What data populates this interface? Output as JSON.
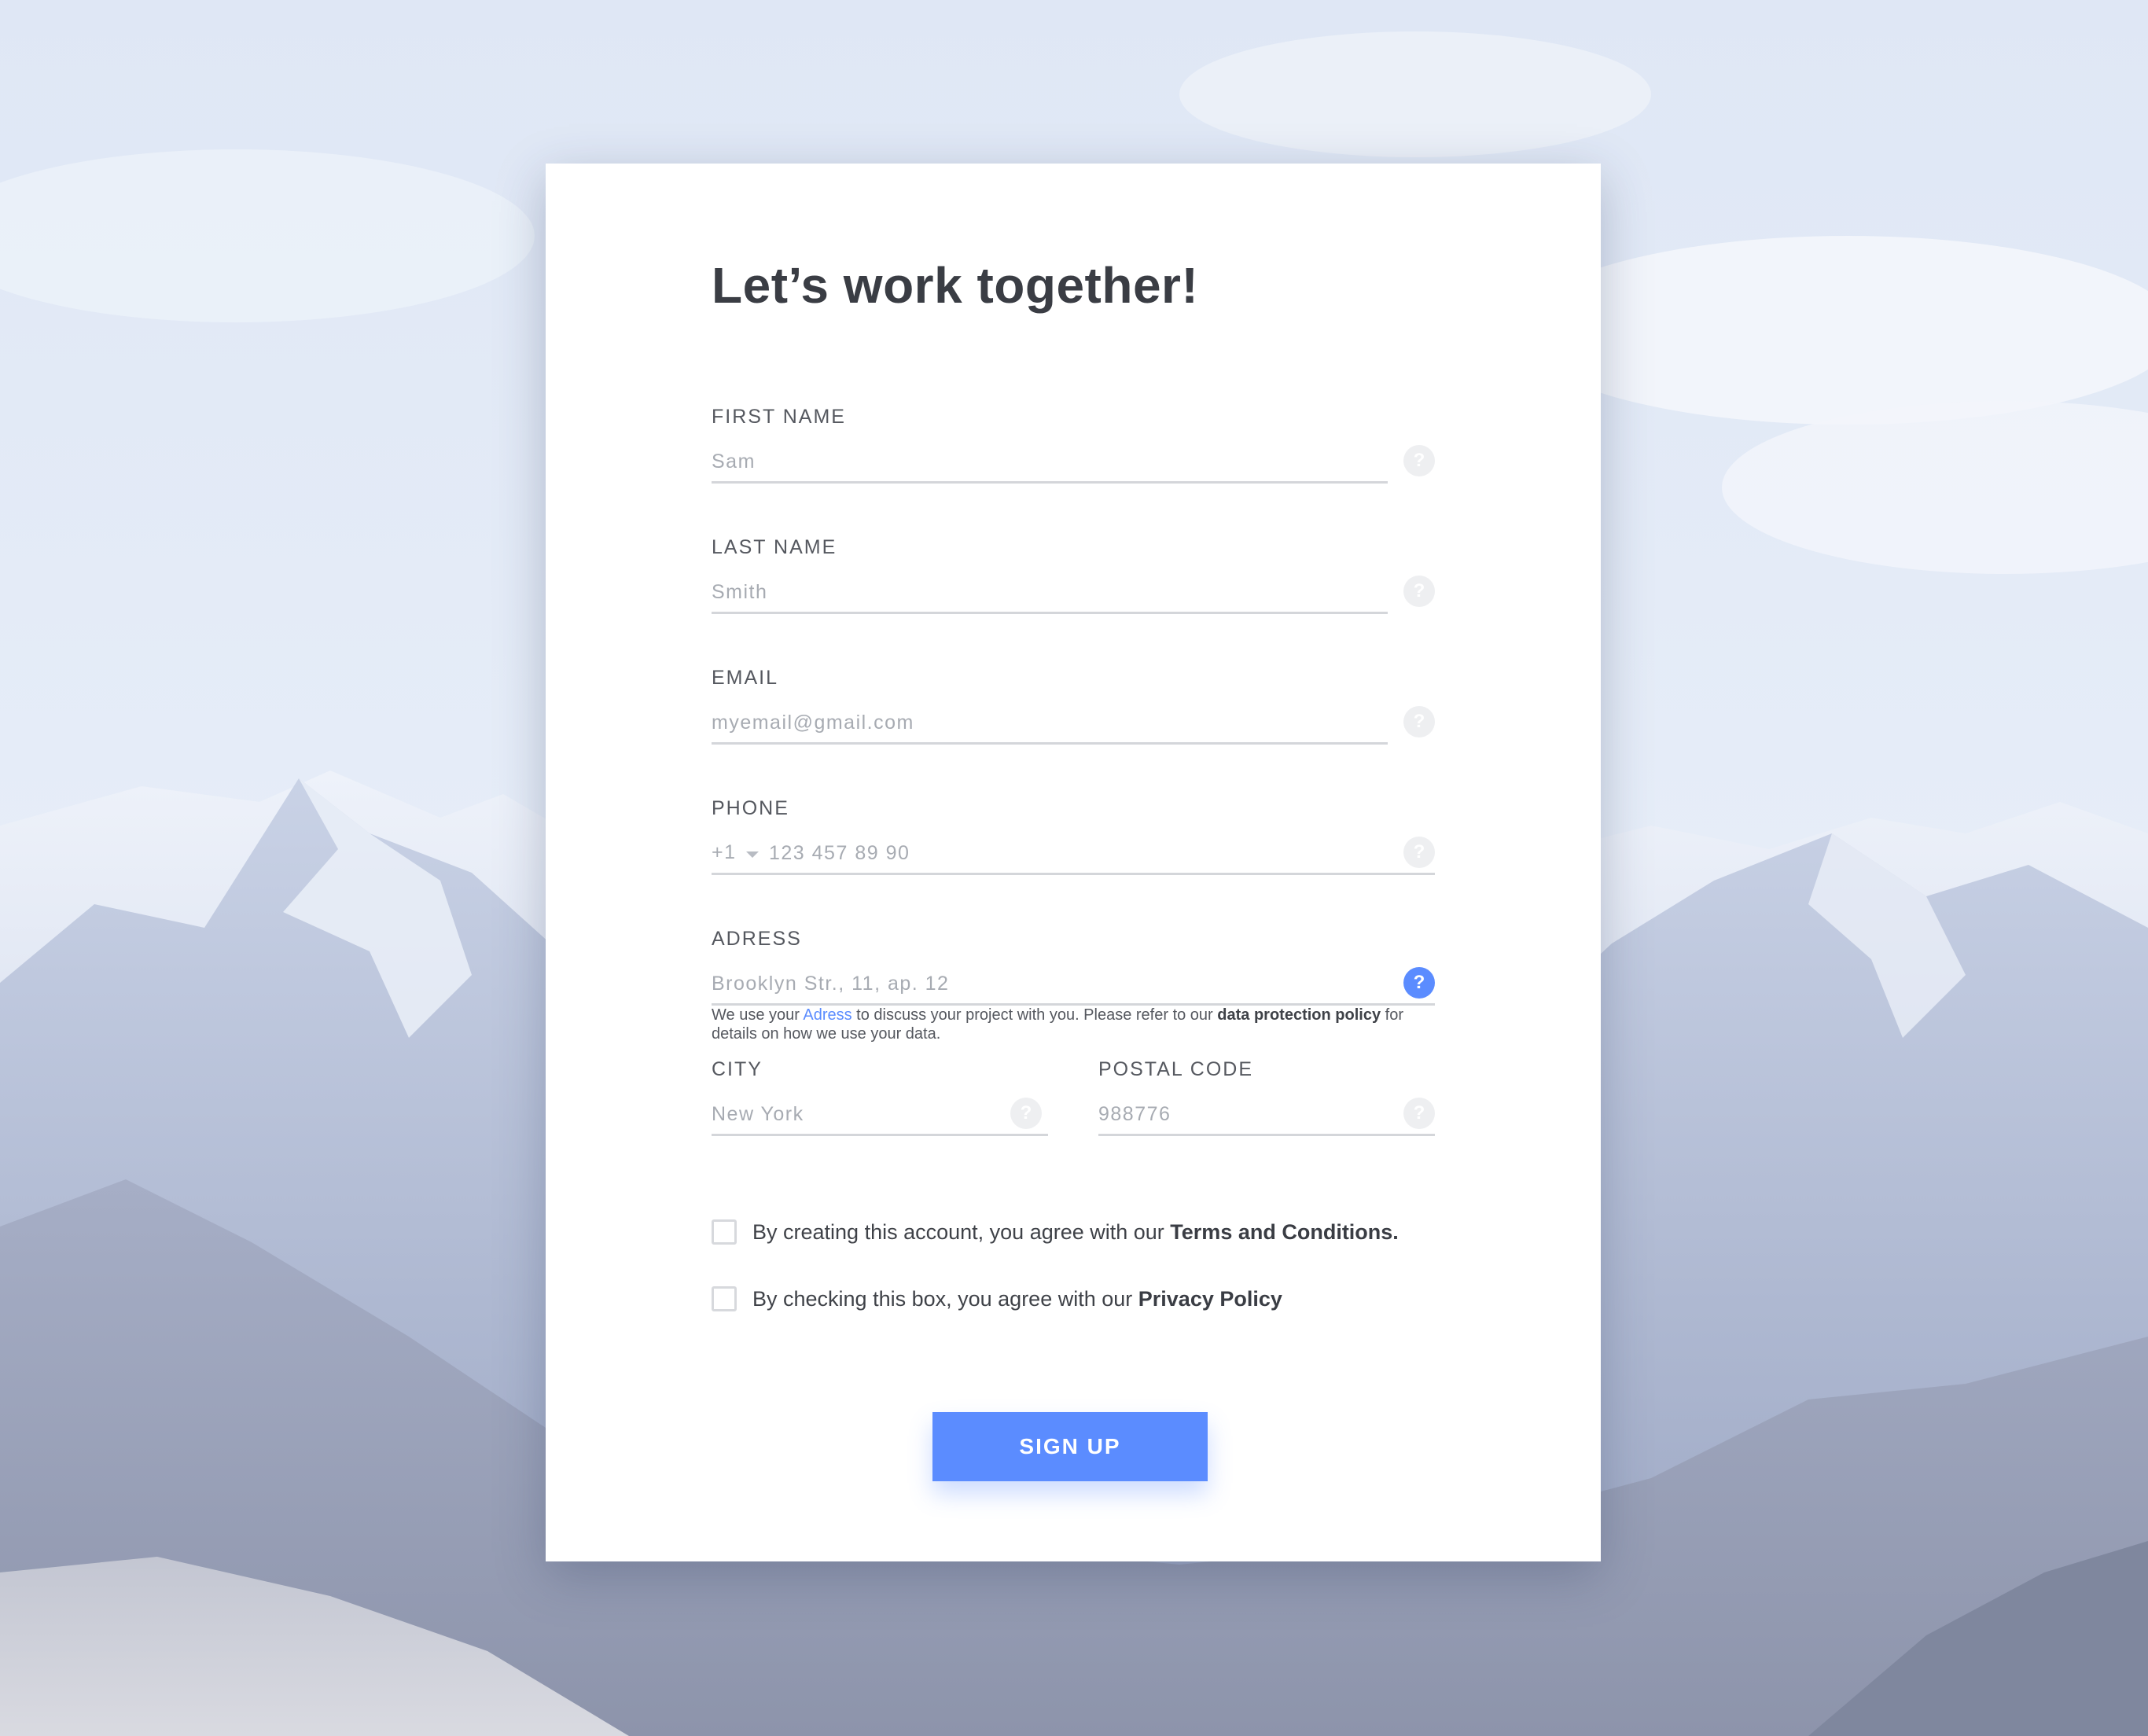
{
  "form": {
    "title": "Let’s work together!",
    "fields": {
      "first_name": {
        "label": "FIRST NAME",
        "placeholder": "Sam",
        "help": "?"
      },
      "last_name": {
        "label": "LAST NAME",
        "placeholder": "Smith",
        "help": "?"
      },
      "email": {
        "label": "EMAIL",
        "placeholder": "myemail@gmail.com",
        "help": "?"
      },
      "phone": {
        "label": "PHONE",
        "country_code": "+1",
        "placeholder": "123 457 89 90",
        "help": "?"
      },
      "address": {
        "label": "ADRESS",
        "placeholder": "Brooklyn Str., 11, ap. 12",
        "help": "?"
      },
      "city": {
        "label": "CITY",
        "placeholder": "New York",
        "help": "?"
      },
      "postal_code": {
        "label": "POSTAL CODE",
        "placeholder": "988776",
        "help": "?"
      }
    },
    "address_hint": {
      "part1": "We use your ",
      "link": "Adress",
      "part2": " to discuss your project with you. Please refer to our ",
      "policy": "data protection policy",
      "part3": " for details on how we use your data."
    },
    "consents": {
      "terms": {
        "text": "By creating this account, you agree with our ",
        "bold": "Terms and Conditions.",
        "checked": false
      },
      "privacy": {
        "text": "By checking this box, you agree with our ",
        "bold": "Privacy Policy",
        "checked": false
      }
    },
    "submit_label": "SIGN UP"
  },
  "colors": {
    "accent": "#5b8cff",
    "title": "#3a3d44",
    "label": "#55585f",
    "placeholder": "#a7abb2",
    "underline": "#d4d6da"
  }
}
